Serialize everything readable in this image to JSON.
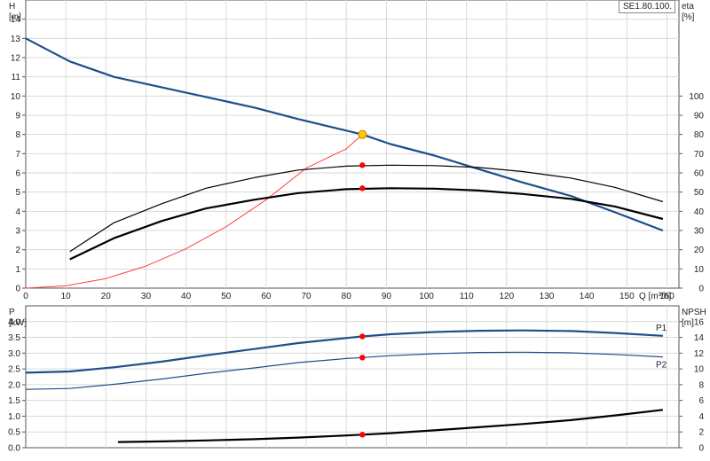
{
  "model_label": "SE1.80.100.",
  "colors": {
    "head_curve": "#1f4e8c",
    "system_curve": "#ff4040",
    "efficiency_curve": "#000000",
    "power_curve": "#1f4e8c",
    "npsh_curve": "#000000",
    "duty_point": "#ff0000",
    "intersection_point": "#ffcc00",
    "grid": "#d9d9d9"
  },
  "chart_data": [
    {
      "type": "line",
      "xlabel": "Q [m³/h]",
      "ylabel_left": "H\n[m]",
      "ylabel_right": "eta\n[%]",
      "x_ticks": [
        0,
        10,
        20,
        30,
        40,
        50,
        60,
        70,
        80,
        90,
        100,
        110,
        120,
        130,
        140,
        150,
        160
      ],
      "xlim": [
        0,
        163
      ],
      "ylim_left": [
        0,
        15
      ],
      "y_ticks_left": [
        0,
        1,
        2,
        3,
        4,
        5,
        6,
        7,
        8,
        9,
        10,
        11,
        12,
        13,
        14
      ],
      "ylim_right": [
        0,
        150
      ],
      "y_ticks_right": [
        0,
        10,
        20,
        30,
        40,
        50,
        60,
        70,
        80,
        90,
        100
      ],
      "grid": true,
      "series": [
        {
          "axis": "left",
          "role": "head",
          "x": [
            0,
            11,
            22,
            34,
            45,
            57,
            68,
            80,
            84,
            91,
            102,
            113,
            124,
            136,
            147,
            159
          ],
          "y": [
            13.0,
            11.8,
            11.0,
            10.45,
            9.95,
            9.4,
            8.8,
            8.2,
            8.0,
            7.5,
            6.9,
            6.2,
            5.5,
            4.8,
            3.95,
            3.0
          ]
        },
        {
          "axis": "left",
          "role": "system",
          "x": [
            0,
            10,
            20,
            30,
            40,
            50,
            60,
            70,
            80,
            84
          ],
          "y": [
            0,
            0.12,
            0.5,
            1.15,
            2.05,
            3.2,
            4.6,
            6.25,
            7.25,
            8.0
          ]
        },
        {
          "axis": "right",
          "role": "efficiency",
          "x": [
            11,
            22,
            34,
            45,
            57,
            68,
            80,
            91,
            102,
            113,
            124,
            136,
            147,
            159
          ],
          "y": [
            19,
            34,
            44,
            52,
            57.5,
            61.5,
            63.5,
            64,
            63.8,
            62.8,
            60.7,
            57.3,
            52.5,
            45
          ]
        },
        {
          "axis": "right",
          "role": "efficiency_pump",
          "x": [
            11,
            22,
            34,
            45,
            57,
            68,
            80,
            91,
            102,
            113,
            124,
            136,
            147,
            159
          ],
          "y": [
            15,
            26,
            35,
            41.5,
            46,
            49.5,
            51.5,
            52,
            51.8,
            50.8,
            49,
            46.5,
            42.5,
            36
          ]
        }
      ],
      "duty_points": [
        {
          "axis": "left",
          "x": 84,
          "y": 8.0,
          "kind": "intersection"
        },
        {
          "axis": "right",
          "x": 84,
          "y": 64
        },
        {
          "axis": "right",
          "x": 84,
          "y": 52
        }
      ]
    },
    {
      "type": "line",
      "ylabel_left": "P\n[kW]",
      "ylabel_right": "NPSH\n[m]",
      "xlim": [
        0,
        163
      ],
      "ylim_left": [
        0,
        4.5
      ],
      "y_ticks_left": [
        0.0,
        0.5,
        1.0,
        1.5,
        2.0,
        2.5,
        3.0,
        3.5,
        4.0
      ],
      "ylim_right": [
        0,
        18
      ],
      "y_ticks_right": [
        0,
        2,
        4,
        6,
        8,
        10,
        12,
        14,
        16
      ],
      "grid": true,
      "series": [
        {
          "axis": "left",
          "name": "P1",
          "x": [
            0,
            11,
            22,
            34,
            45,
            57,
            68,
            80,
            84,
            91,
            102,
            113,
            124,
            136,
            147,
            159
          ],
          "y": [
            2.38,
            2.42,
            2.55,
            2.73,
            2.93,
            3.13,
            3.32,
            3.48,
            3.53,
            3.6,
            3.67,
            3.71,
            3.72,
            3.7,
            3.64,
            3.55
          ]
        },
        {
          "axis": "left",
          "name": "P2",
          "x": [
            0,
            11,
            22,
            34,
            45,
            57,
            68,
            80,
            84,
            91,
            102,
            113,
            124,
            136,
            147,
            159
          ],
          "y": [
            1.85,
            1.88,
            2.01,
            2.18,
            2.36,
            2.53,
            2.7,
            2.83,
            2.86,
            2.92,
            2.98,
            3.02,
            3.03,
            3.01,
            2.96,
            2.88
          ]
        },
        {
          "axis": "right",
          "role": "npsh",
          "x": [
            23,
            34,
            45,
            57,
            68,
            80,
            84,
            91,
            102,
            113,
            124,
            136,
            147,
            159
          ],
          "y": [
            0.72,
            0.8,
            0.92,
            1.08,
            1.28,
            1.55,
            1.65,
            1.85,
            2.2,
            2.6,
            3.0,
            3.5,
            4.1,
            4.8
          ]
        }
      ],
      "duty_points": [
        {
          "axis": "left",
          "x": 84,
          "y": 3.53
        },
        {
          "axis": "left",
          "x": 84,
          "y": 2.86
        },
        {
          "axis": "right",
          "x": 84,
          "y": 1.65
        }
      ]
    }
  ]
}
